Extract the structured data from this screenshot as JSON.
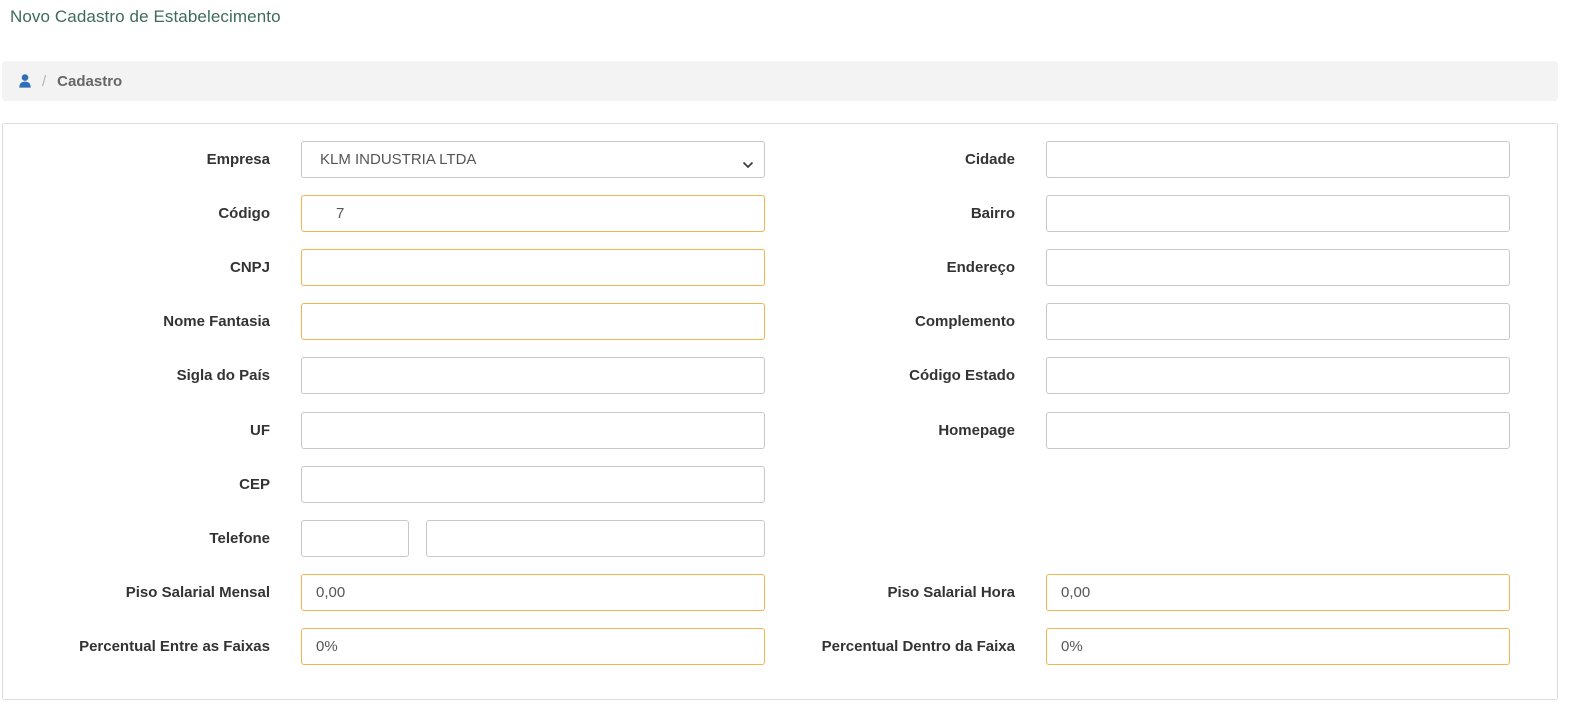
{
  "page": {
    "title": "Novo Cadastro de Estabelecimento"
  },
  "breadcrumb": {
    "icon": "user-icon",
    "separator": "/",
    "current": "Cadastro"
  },
  "form": {
    "left": {
      "empresa": {
        "label": "Empresa",
        "value": "KLM INDUSTRIA LTDA"
      },
      "codigo": {
        "label": "Código",
        "value": "7"
      },
      "cnpj": {
        "label": "CNPJ",
        "value": ""
      },
      "nome_fantasia": {
        "label": "Nome Fantasia",
        "value": ""
      },
      "sigla_pais": {
        "label": "Sigla do País",
        "value": ""
      },
      "uf": {
        "label": "UF",
        "value": ""
      },
      "cep": {
        "label": "CEP",
        "value": ""
      },
      "telefone": {
        "label": "Telefone",
        "ddd": "",
        "numero": ""
      },
      "piso_mensal": {
        "label": "Piso Salarial Mensal",
        "value": "0,00"
      },
      "percentual_faixas": {
        "label": "Percentual Entre as Faixas",
        "value": "0%"
      }
    },
    "right": {
      "cidade": {
        "label": "Cidade",
        "value": ""
      },
      "bairro": {
        "label": "Bairro",
        "value": ""
      },
      "endereco": {
        "label": "Endereço",
        "value": ""
      },
      "complemento": {
        "label": "Complemento",
        "value": ""
      },
      "codigo_estado": {
        "label": "Código Estado",
        "value": ""
      },
      "homepage": {
        "label": "Homepage",
        "value": ""
      },
      "piso_hora": {
        "label": "Piso Salarial Hora",
        "value": "0,00"
      },
      "percentual_dentro": {
        "label": "Percentual Dentro da Faixa",
        "value": "0%"
      }
    }
  },
  "colors": {
    "title": "#3e6b5b",
    "required_border": "#f0b54f",
    "icon": "#2f6fb5"
  }
}
